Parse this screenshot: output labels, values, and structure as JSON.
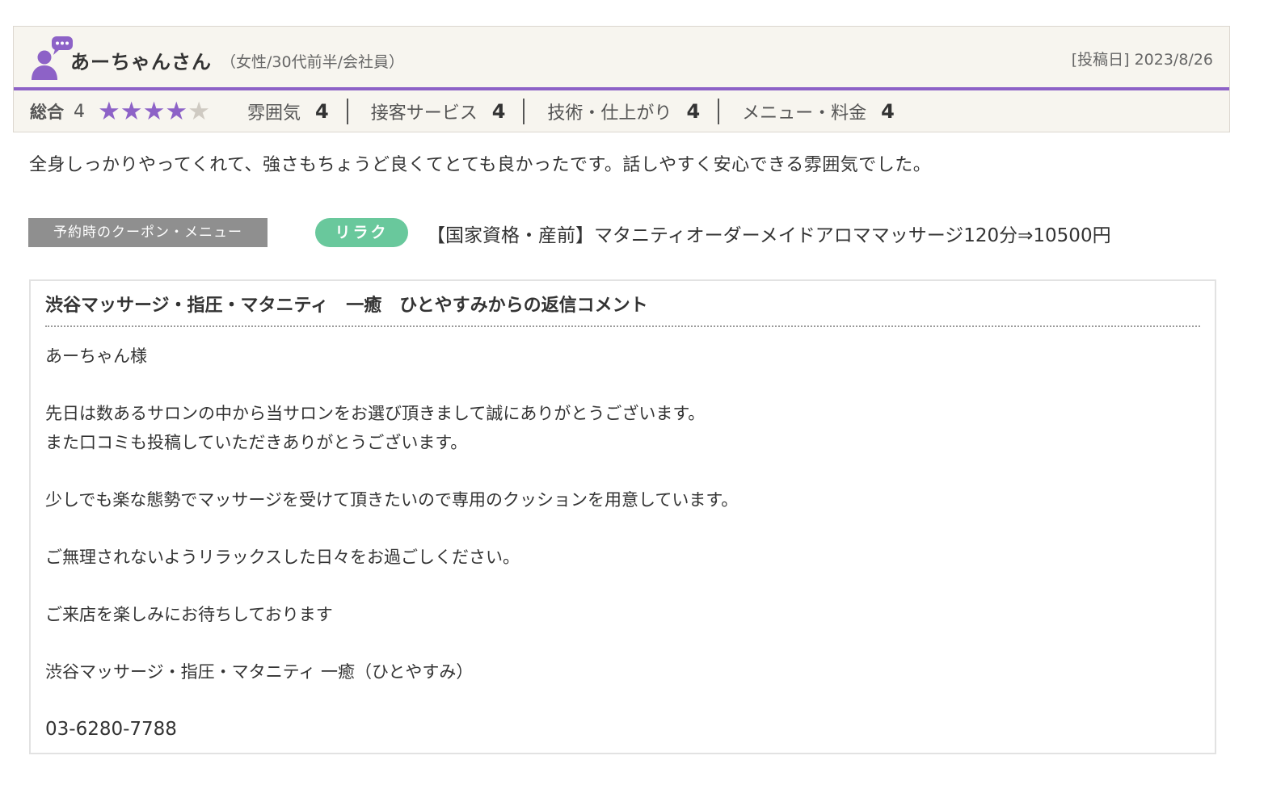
{
  "review": {
    "user_name": "あーちゃんさん",
    "user_meta": "（女性/30代前半/会社員）",
    "post_date_label": "[投稿日]",
    "post_date": "2023/8/26",
    "overall_label": "総合",
    "overall_score": "4",
    "stars_filled": 4,
    "stars_total": 5,
    "sub_ratings": [
      {
        "label": "雰囲気",
        "score": "4"
      },
      {
        "label": "接客サービス",
        "score": "4"
      },
      {
        "label": "技術・仕上がり",
        "score": "4"
      },
      {
        "label": "メニュー・料金",
        "score": "4"
      }
    ],
    "comment": "全身しっかりやってくれて、強さもちょうど良くてとても良かったです。話しやすく安心できる雰囲気でした。"
  },
  "coupon": {
    "label": "予約時のクーポン・メニュー",
    "badge": "リラク",
    "text": "【国家資格・産前】マタニティオーダーメイドアロママッサージ120分⇒10500円"
  },
  "reply": {
    "title": "渋谷マッサージ・指圧・マタニティ　一癒　ひとやすみからの返信コメント",
    "greeting": "あーちゃん様",
    "line1": "先日は数あるサロンの中から当サロンをお選び頂きまして誠にありがとうございます。",
    "line2": "また口コミも投稿していただきありがとうございます。",
    "line3": "少しでも楽な態勢でマッサージを受けて頂きたいので専用のクッションを用意しています。",
    "line4": "ご無理されないようリラックスした日々をお過ごしください。",
    "line5": "ご来店を楽しみにお待ちしております",
    "signature": "渋谷マッサージ・指圧・マタニティ 一癒（ひとやすみ）",
    "phone": "03-6280-7788"
  },
  "colors": {
    "accent_purple": "#8d62c7",
    "badge_green": "#69c89c",
    "coupon_gray": "#8f8f8f",
    "card_bg": "#f7f5ef",
    "phone_link": "#5b5a8f"
  },
  "icons": {
    "user": "user-speech-bubble-icon",
    "star": "star-icon"
  }
}
